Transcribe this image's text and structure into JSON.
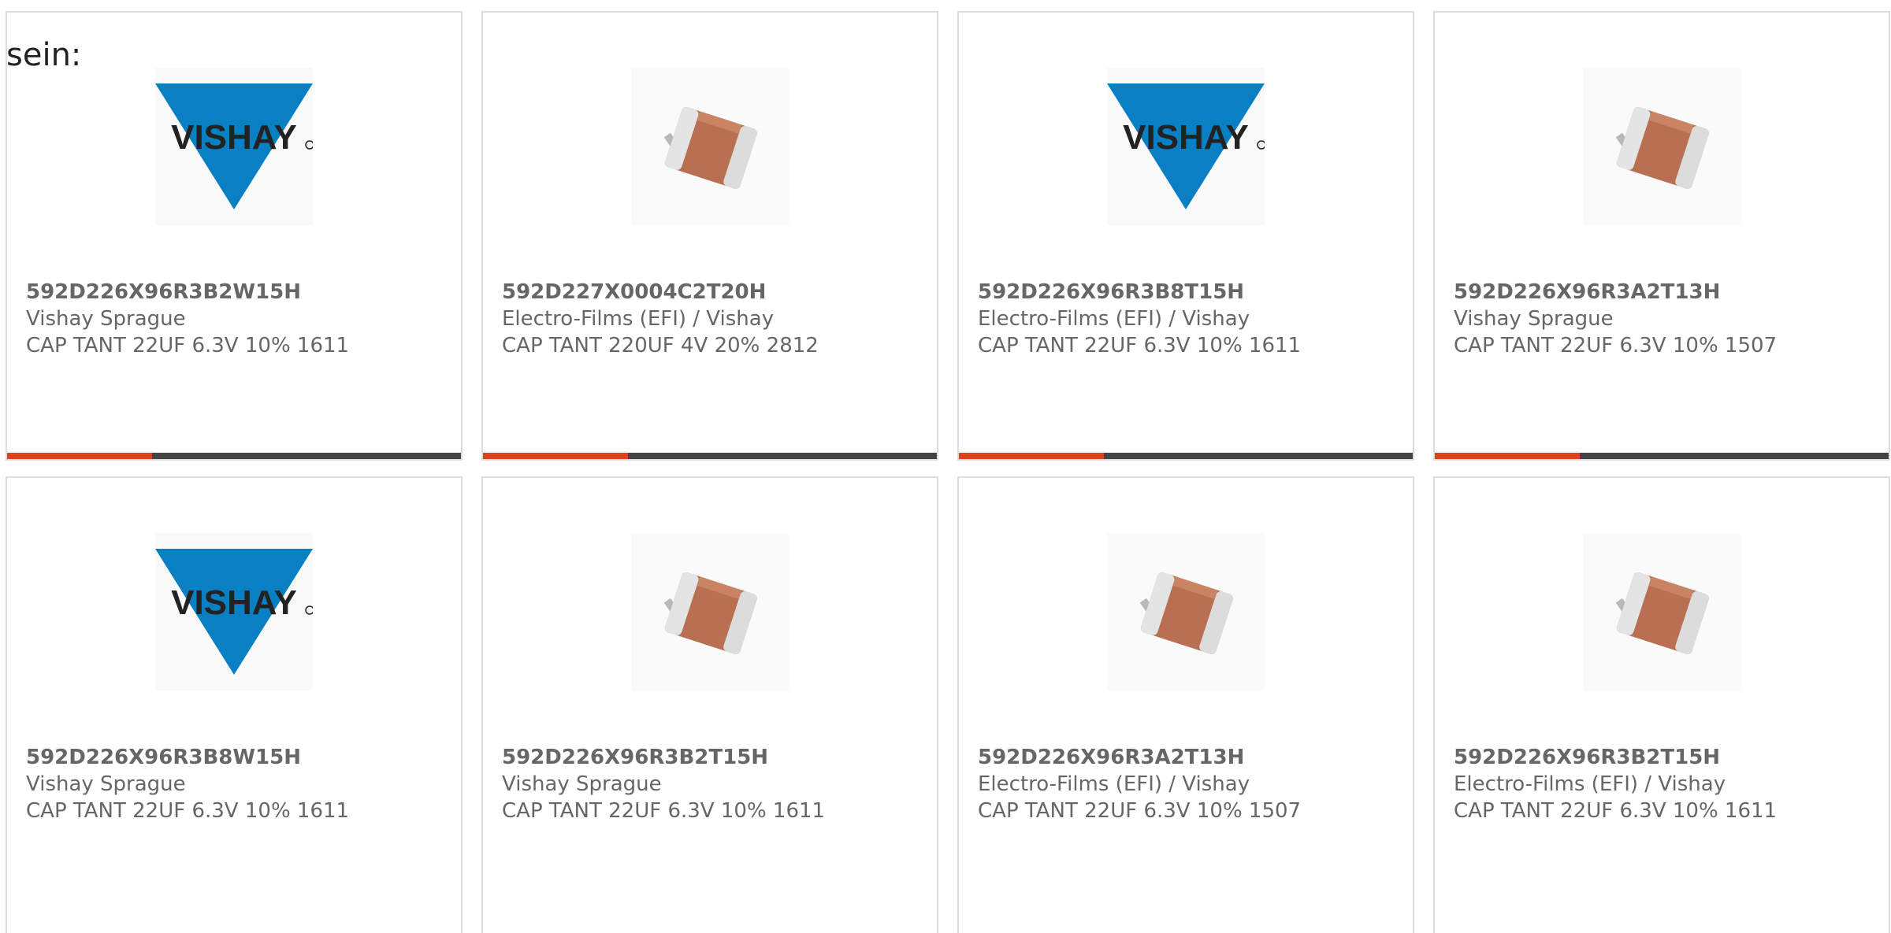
{
  "intro_text": "sein:",
  "colors": {
    "accent": "#e0401c",
    "bar_track": "#444444",
    "text": "#666666",
    "border": "#dddddd",
    "vishay_blue": "#0a80c4"
  },
  "products": [
    {
      "part_number": "592D226X96R3B2W15H",
      "manufacturer": "Vishay Sprague",
      "description": "CAP TANT 22UF 6.3V 10% 1611",
      "image": "vishay-logo",
      "bar_fill": 0.32
    },
    {
      "part_number": "592D227X0004C2T20H",
      "manufacturer": "Electro-Films (EFI) / Vishay",
      "description": "CAP TANT 220UF 4V 20% 2812",
      "image": "capacitor-chip",
      "bar_fill": 0.32
    },
    {
      "part_number": "592D226X96R3B8T15H",
      "manufacturer": "Electro-Films (EFI) / Vishay",
      "description": "CAP TANT 22UF 6.3V 10% 1611",
      "image": "vishay-logo",
      "bar_fill": 0.32
    },
    {
      "part_number": "592D226X96R3A2T13H",
      "manufacturer": "Vishay Sprague",
      "description": "CAP TANT 22UF 6.3V 10% 1507",
      "image": "capacitor-chip",
      "bar_fill": 0.32
    },
    {
      "part_number": "592D226X96R3B8W15H",
      "manufacturer": "Vishay Sprague",
      "description": "CAP TANT 22UF 6.3V 10% 1611",
      "image": "vishay-logo"
    },
    {
      "part_number": "592D226X96R3B2T15H",
      "manufacturer": "Vishay Sprague",
      "description": "CAP TANT 22UF 6.3V 10% 1611",
      "image": "capacitor-chip"
    },
    {
      "part_number": "592D226X96R3A2T13H",
      "manufacturer": "Electro-Films (EFI) / Vishay",
      "description": "CAP TANT 22UF 6.3V 10% 1507",
      "image": "capacitor-chip"
    },
    {
      "part_number": "592D226X96R3B2T15H",
      "manufacturer": "Electro-Films (EFI) / Vishay",
      "description": "CAP TANT 22UF 6.3V 10% 1611",
      "image": "capacitor-chip"
    }
  ]
}
